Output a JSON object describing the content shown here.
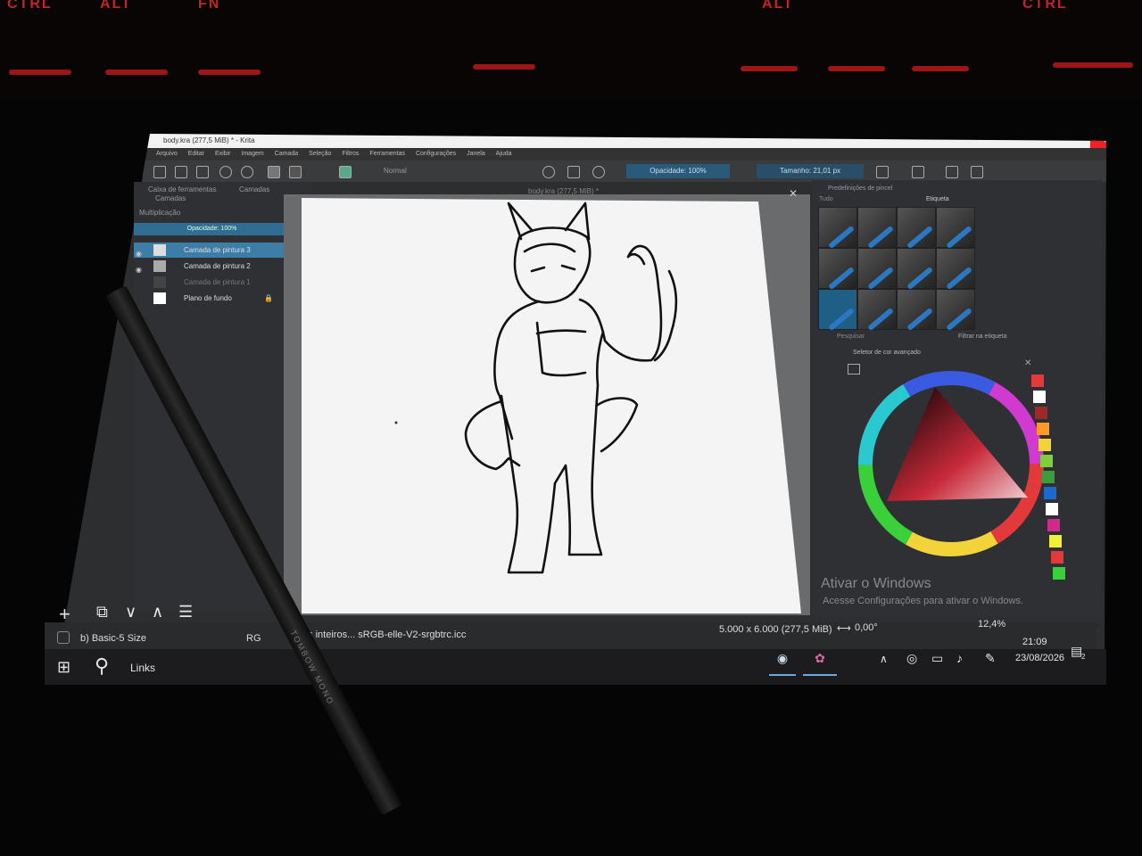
{
  "keyboard": {
    "keys": [
      "CTRL",
      "ALT",
      "FN",
      "ALT",
      "CTRL"
    ]
  },
  "window": {
    "title": "body.kra (277,5 MiB) * - Krita",
    "doc_tab": "body.kra (277,5 MiB) *"
  },
  "menubar": {
    "items": [
      "Arquivo",
      "Editar",
      "Exibir",
      "Imagem",
      "Camada",
      "Seleção",
      "Filtros",
      "Ferramentas",
      "Configurações",
      "Janela",
      "Ajuda"
    ]
  },
  "toolbar": {
    "blend_mode": "Normal",
    "opacity": "Opacidade: 100%",
    "size": "Tamanho: 21,01 px"
  },
  "left_panel": {
    "tab_tools": "Caixa de ferramentas",
    "tab_layers": "Camadas",
    "header": "Camadas",
    "blend": "Multiplicação",
    "opacity": "Opacidade: 100%",
    "layers": [
      {
        "name": "Camada de pintura 3",
        "selected": true
      },
      {
        "name": "Camada de pintura 2",
        "selected": false
      },
      {
        "name": "Camada de pintura 1",
        "selected": false
      },
      {
        "name": "Plano de fundo",
        "selected": false
      }
    ]
  },
  "right_panel": {
    "presets_title": "Predefinições de pincel",
    "presets_tag": "Tudo",
    "presets_tag_label": "Etiqueta",
    "search": "Pesquisar",
    "filter": "Filtrar na etiqueta",
    "color_title": "Seletor de cor avançado",
    "palette_colors": [
      "#e23a3a",
      "#ffffff",
      "#9c2a2a",
      "#ff9a2a",
      "#f2d43a",
      "#7fcf3a",
      "#3a9c3a",
      "#1c6ad0",
      "#ffffff",
      "#d02a8a",
      "#f2ee3a",
      "#e23a3a",
      "#3ad03a"
    ]
  },
  "status": {
    "brush": "b) Basic-5 Size",
    "color_profile_prefix": "RG",
    "color_profile": "ts inteiros... sRGB-elle-V2-srgbtrc.icc",
    "dimensions": "5.000 x 6.000 (277,5 MiB)",
    "rotation": "0,00°",
    "zoom": "12,4%"
  },
  "watermark": {
    "line1": "Ativar o Windows",
    "line2": "Acesse Configurações para ativar o Windows."
  },
  "taskbar": {
    "search_label": "Links",
    "time": "21:09",
    "date": "23/08/2026",
    "notifications": "2"
  },
  "pencil": {
    "brand": "TOMBOW MONO"
  }
}
